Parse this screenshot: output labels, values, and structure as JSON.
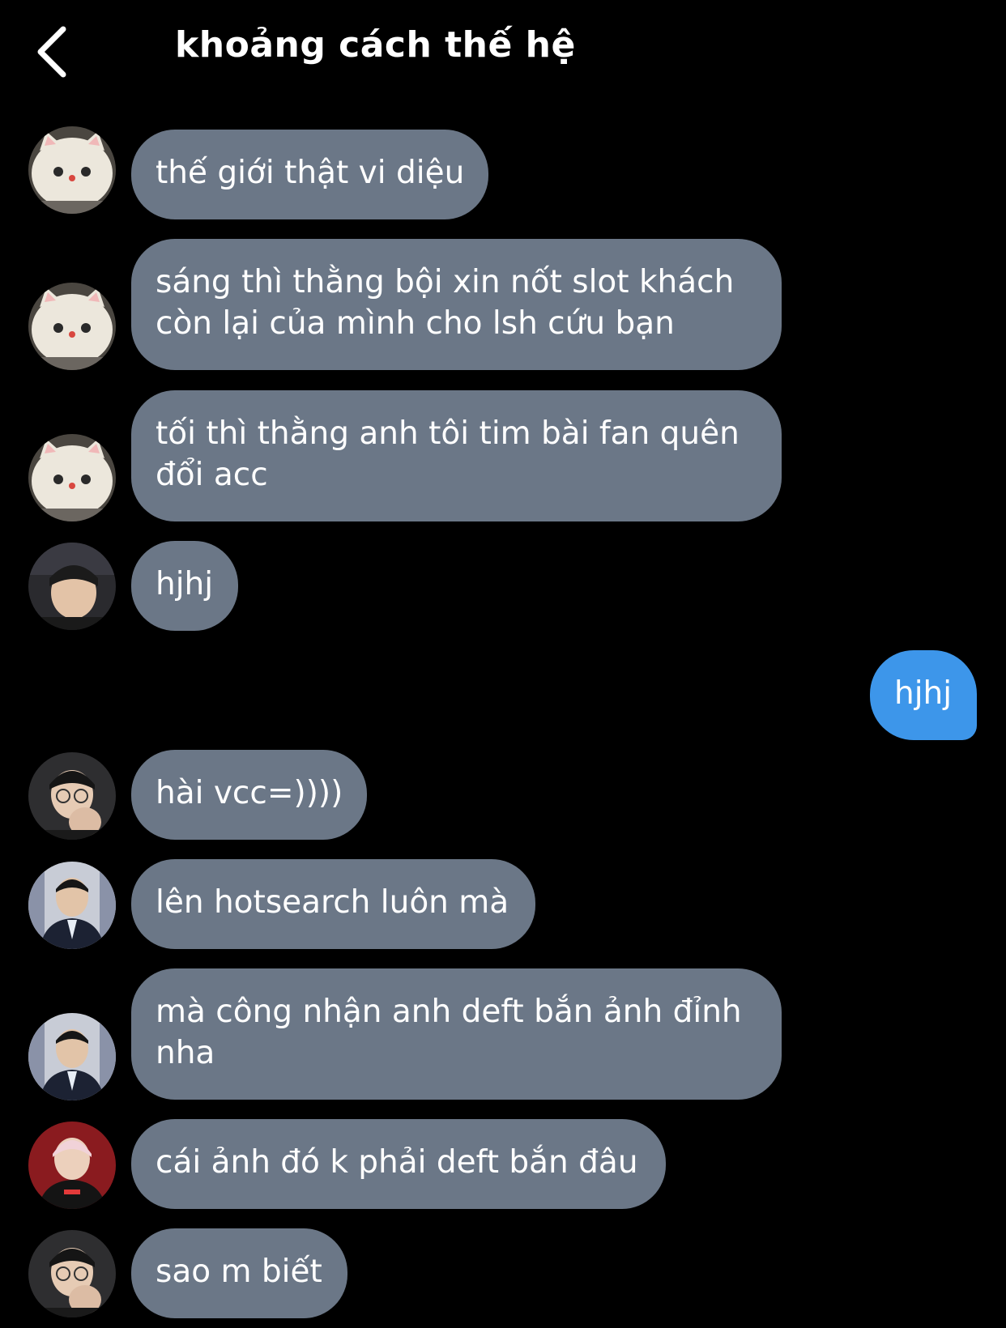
{
  "header": {
    "title": "khoảng cách thế hệ",
    "back_icon": "chevron-left-icon"
  },
  "colors": {
    "background": "#000000",
    "incoming_bubble": "#6b7787",
    "outgoing_bubble": "#3d96ea",
    "text": "#ffffff"
  },
  "messages": [
    {
      "direction": "incoming",
      "avatar": "cat-plush-avatar",
      "lines": [
        "thế giới thật vi diệu"
      ]
    },
    {
      "direction": "incoming",
      "avatar": "cat-plush-avatar",
      "lines": [
        "sáng thì thằng bội xin nốt slot khách",
        "còn lại của mình cho lsh cứu bạn"
      ]
    },
    {
      "direction": "incoming",
      "avatar": "cat-plush-avatar",
      "lines": [
        "tối thì thằng anh tôi tim bài fan quên",
        "đổi acc"
      ]
    },
    {
      "direction": "incoming",
      "avatar": "person-avatar",
      "lines": [
        "hjhj"
      ]
    },
    {
      "direction": "outgoing",
      "lines": [
        "hjhj"
      ]
    },
    {
      "direction": "incoming",
      "avatar": "person-glasses-avatar",
      "lines": [
        "hài vcc=))))"
      ]
    },
    {
      "direction": "incoming",
      "avatar": "person-suit-avatar",
      "lines": [
        "lên hotsearch luôn mà"
      ]
    },
    {
      "direction": "incoming",
      "avatar": "person-suit-avatar",
      "lines": [
        "mà công nhận anh deft bắn ảnh đỉnh",
        "nha"
      ]
    },
    {
      "direction": "incoming",
      "avatar": "person-jersey-avatar",
      "lines": [
        "cái ảnh đó k phải deft bắn đâu"
      ]
    },
    {
      "direction": "incoming",
      "avatar": "person-glasses-avatar",
      "lines": [
        "sao m biết"
      ]
    }
  ]
}
